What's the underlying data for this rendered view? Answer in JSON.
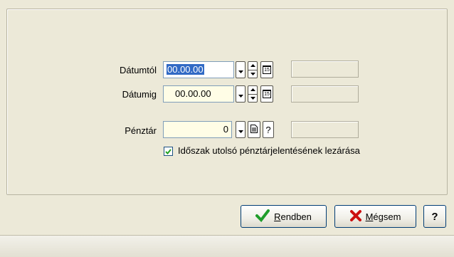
{
  "form": {
    "date_from": {
      "label": "Dátumtól",
      "value": "00.00.00"
    },
    "date_to": {
      "label": "Dátumig",
      "value": "00.00.00"
    },
    "cashbox": {
      "label": "Pénztár",
      "value": "0",
      "help_text": "?"
    },
    "close_period": {
      "label": "Időszak utolsó pénztárjelentésének lezárása",
      "checked": true
    }
  },
  "buttons": {
    "ok": {
      "label": "Rendben",
      "mnemonic": "R",
      "rest": "endben"
    },
    "cancel": {
      "label": "Mégsem",
      "mnemonic": "M",
      "rest": "égsem"
    },
    "help": "?"
  },
  "icons": {
    "calendar_day": "15"
  }
}
